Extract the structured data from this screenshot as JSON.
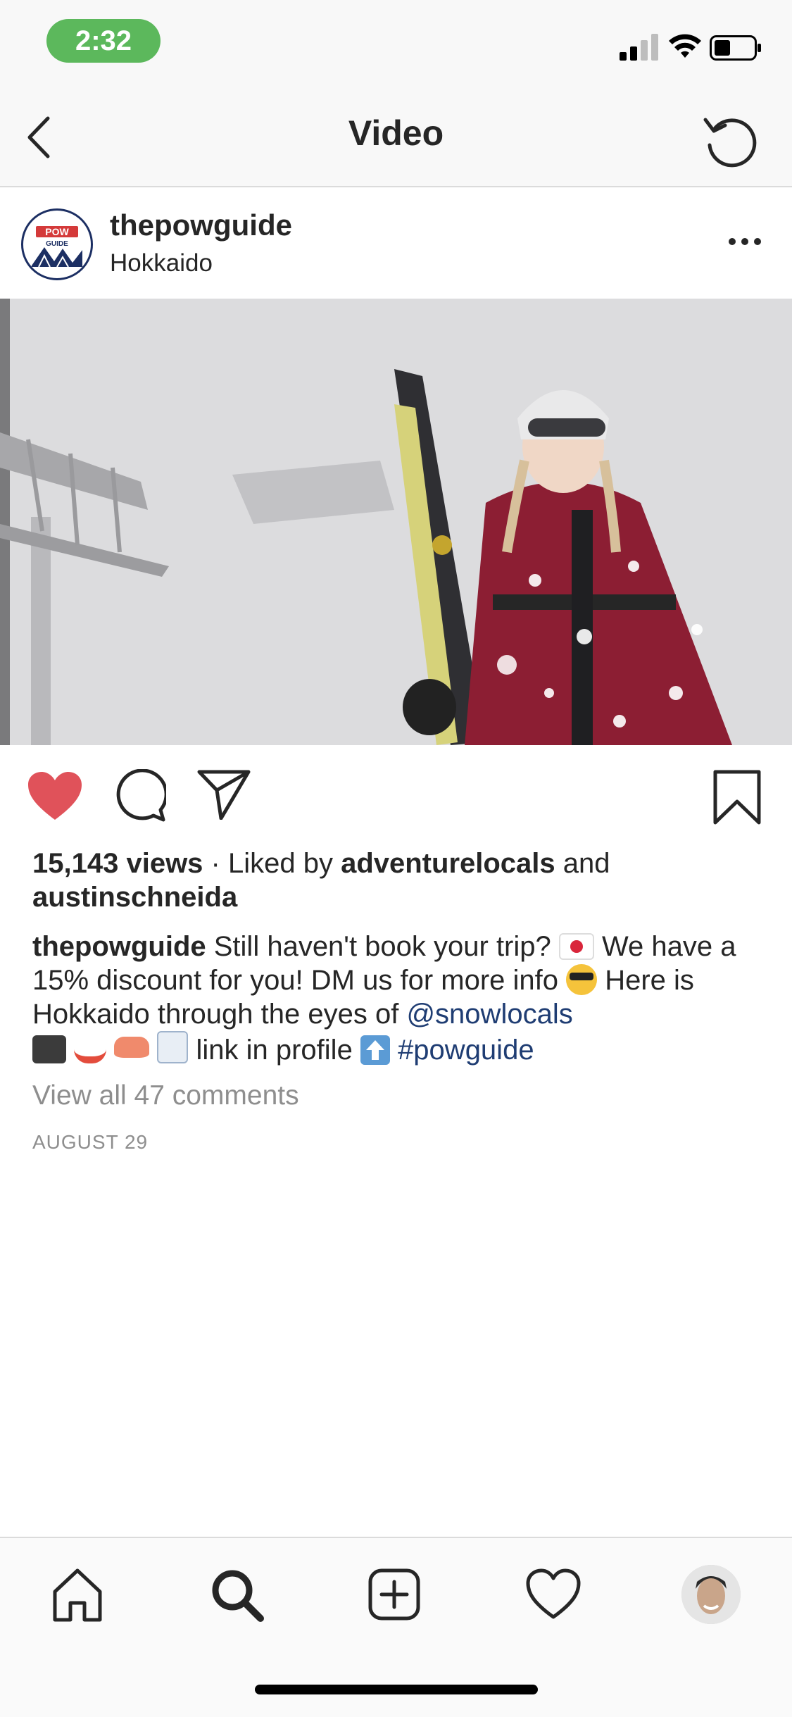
{
  "status_bar": {
    "time": "2:32"
  },
  "nav": {
    "title": "Video"
  },
  "post": {
    "username": "thepowguide",
    "location": "Hokkaido",
    "avatar_text": "POW GUIDE"
  },
  "engagement": {
    "views": "15,143 views",
    "separator": " · ",
    "liked_by_prefix": "Liked by ",
    "liked_user": "adventurelocals",
    "and": " and ",
    "other_user": "austinschneida"
  },
  "caption": {
    "author": "thepowguide",
    "text_1": " Still haven't book your trip? ",
    "text_2": " We have a 15% discount for you! DM us for more info ",
    "text_3": " Here is Hokkaido through the eyes of ",
    "mention": "@snowlocals",
    "text_4": " link in profile ",
    "hashtag": "#powguide"
  },
  "comments": {
    "view_all": "View all 47 comments"
  },
  "date": "AUGUST 29",
  "colors": {
    "like": "#e0525a",
    "link": "#1f3d73",
    "meta": "#8e8e8e"
  },
  "icons": {
    "back": "chevron-left-icon",
    "refresh": "refresh-icon",
    "more": "more-horizontal-icon",
    "like": "heart-filled-icon",
    "comment": "comment-bubble-icon",
    "share": "send-icon",
    "save": "bookmark-icon",
    "tabs": [
      "home-icon",
      "search-icon",
      "add-post-icon",
      "activity-heart-icon",
      "profile-avatar"
    ]
  }
}
